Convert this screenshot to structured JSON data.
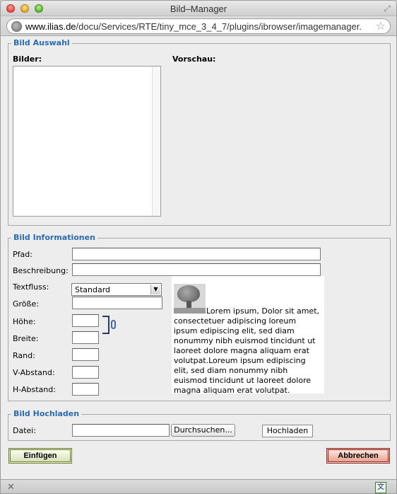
{
  "window": {
    "title": "Bild–Manager"
  },
  "address_bar": {
    "host": "www.ilias.de",
    "path": "/docu/Services/RTE/tiny_mce_3_4_7/plugins/ibrowser/imagemanager."
  },
  "sections": {
    "auswahl": {
      "legend": "Bild Auswahl",
      "bilder_label": "Bilder:",
      "vorschau_label": "Vorschau:"
    },
    "informationen": {
      "legend": "Bild Informationen",
      "pfad_label": "Pfad:",
      "beschreibung_label": "Beschreibung:",
      "textfluss_label": "Textfluss:",
      "textfluss_value": "Standard",
      "groesse_label": "Größe:",
      "hoehe_label": "Höhe:",
      "breite_label": "Breite:",
      "rand_label": "Rand:",
      "vabstand_label": "V-Abstand:",
      "habstand_label": "H-Abstand:",
      "preview_text": "Lorem ipsum, Dolor sit amet, consectetuer adipiscing loreum ipsum edipiscing elit, sed diam nonummy nibh euismod tincidunt ut laoreet dolore magna aliquam erat volutpat.Loreum ipsum edipiscing elit, sed diam nonummy nibh euismod tincidunt ut laoreet dolore magna aliquam erat volutpat."
    },
    "hochladen": {
      "legend": "Bild Hochladen",
      "datei_label": "Datei:",
      "browse_label": "Durchsuchen...",
      "upload_label": "Hochladen"
    }
  },
  "actions": {
    "insert_label": "Einfügen",
    "cancel_label": "Abbrechen"
  },
  "colors": {
    "legend": "#2b6cb0",
    "insert_border": "#6b7d2f",
    "cancel_border": "#8c2a20"
  },
  "icons": [
    "globe-icon",
    "star-icon",
    "resize-icon",
    "chain-icon",
    "tree-image-icon",
    "close-status-icon",
    "translate-icon"
  ]
}
